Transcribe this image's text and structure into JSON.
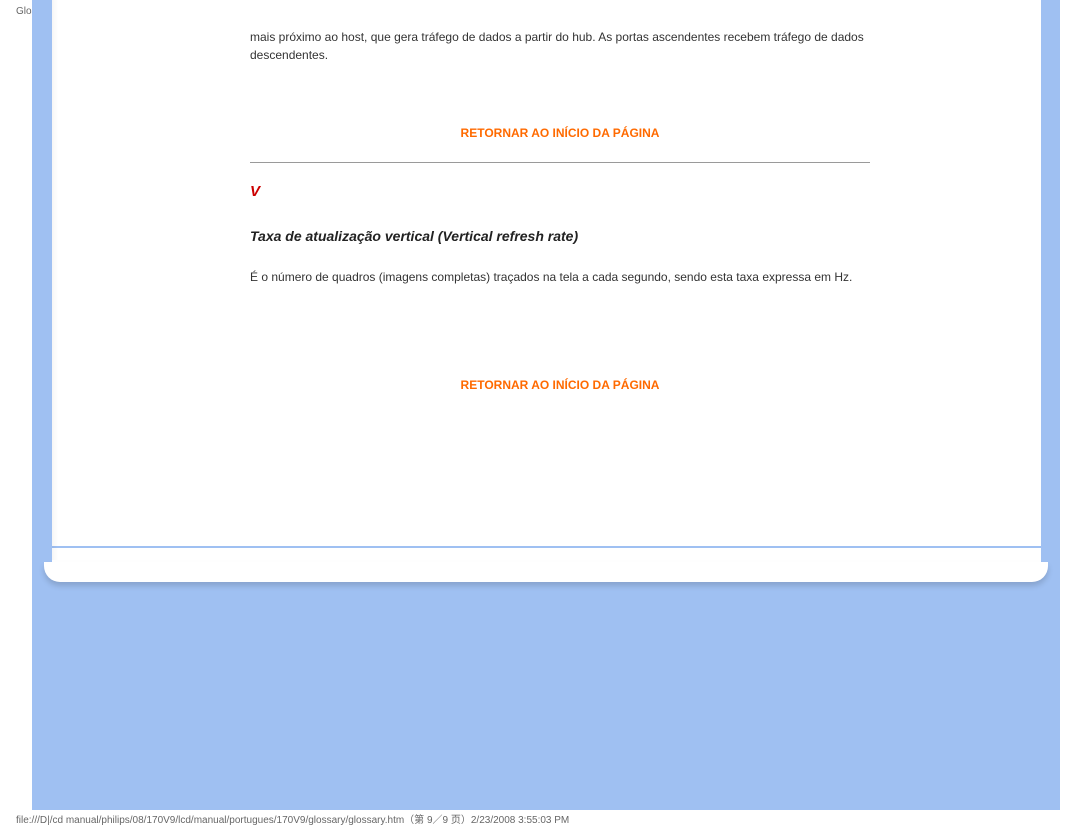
{
  "header": {
    "label": "Glossário"
  },
  "content": {
    "intro_text": "mais próximo ao host, que gera tráfego de dados a partir do hub.  As portas ascendentes  recebem tráfego de dados descendentes.",
    "back_link_label": "RETORNAR AO INÍCIO DA PÁGINA",
    "section_letter": "V",
    "term_title": "Taxa de atualização vertical  (Vertical refresh rate)",
    "term_desc": "É o número de quadros (imagens completas) traçados na tela a cada segundo, sendo esta taxa expressa em Hz."
  },
  "footer": {
    "path": "file:///D|/cd manual/philips/08/170V9/lcd/manual/portugues/170V9/glossary/glossary.htm（第 9／9 页）2/23/2008 3:55:03 PM"
  }
}
